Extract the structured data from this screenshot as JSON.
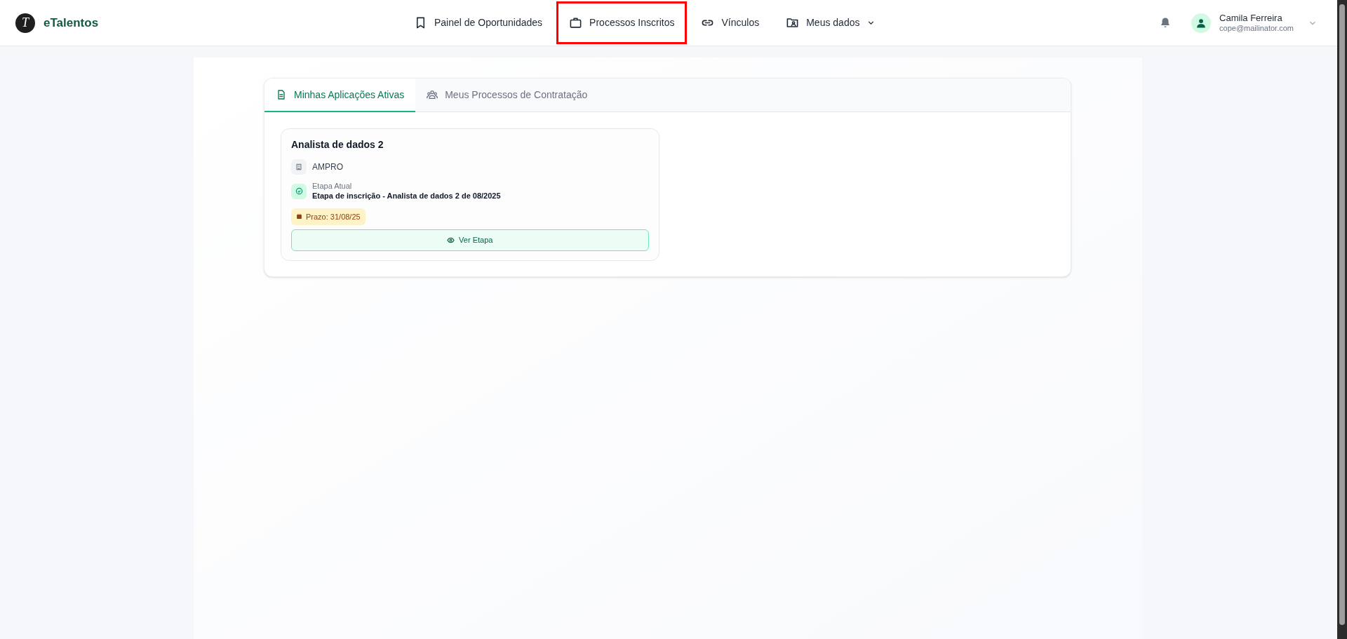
{
  "brand": {
    "logo_letter": "T",
    "name": "eTalentos"
  },
  "nav": [
    {
      "label": "Painel de Oportunidades",
      "kind": "bookmark",
      "highlighted": false,
      "dropdown": false
    },
    {
      "label": "Processos Inscritos",
      "kind": "briefcase",
      "highlighted": true,
      "dropdown": false
    },
    {
      "label": "Vínculos",
      "kind": "link",
      "highlighted": false,
      "dropdown": false
    },
    {
      "label": "Meus dados",
      "kind": "folder-user",
      "highlighted": false,
      "dropdown": true
    }
  ],
  "user": {
    "name": "Camila Ferreira",
    "email": "cope@mailinator.com"
  },
  "tabs": [
    {
      "label": "Minhas Aplicações Ativas",
      "kind": "document",
      "selected": true
    },
    {
      "label": "Meus Processos de Contratação",
      "kind": "users",
      "selected": false
    }
  ],
  "applications": [
    {
      "title": "Analista de dados 2",
      "company": "AMPRO",
      "stage_label": "Etapa Atual",
      "stage": "Etapa de inscrição - Analista de dados 2 de 08/2025",
      "deadline": "Prazo: 31/08/25",
      "action": "Ver Etapa"
    }
  ]
}
